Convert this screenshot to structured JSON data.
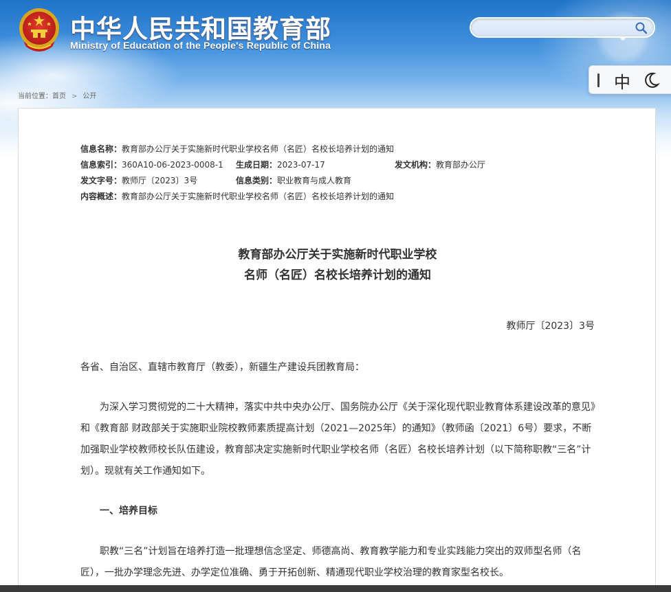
{
  "header": {
    "title": "中华人民共和国教育部",
    "subtitle": "Ministry of Education of the People's Republic of China",
    "search": {
      "value": "",
      "placeholder": ""
    },
    "colors": {
      "sky_top": "#1f74c9",
      "sky_bottom": "#eef6fd"
    }
  },
  "ime": {
    "lang": "中",
    "icon": "moon-icon"
  },
  "breadcrumb": {
    "label": "当前位置：",
    "items": [
      "首页",
      "公开"
    ]
  },
  "meta": {
    "rows": [
      [
        {
          "label": "信息名称：",
          "value": "教育部办公厅关于实施新时代职业学校名师（名匠）名校长培养计划的通知"
        }
      ],
      [
        {
          "label": "信息索引：",
          "value": "360A10-06-2023-0008-1"
        },
        {
          "label": "生成日期：",
          "value": "2023-07-17"
        },
        {
          "label": "发文机构：",
          "value": "教育部办公厅"
        }
      ],
      [
        {
          "label": "发文字号：",
          "value": "教师厅〔2023〕3号"
        },
        {
          "label": "信息类别：",
          "value": "职业教育与成人教育"
        }
      ],
      [
        {
          "label": "内容概述：",
          "value": "教育部办公厅关于实施新时代职业学校名师（名匠）名校长培养计划的通知"
        }
      ]
    ]
  },
  "document": {
    "title_line1": "教育部办公厅关于实施新时代职业学校",
    "title_line2": "名师（名匠）名校长培养计划的通知",
    "number": "教师厅〔2023〕3号",
    "salutation": "各省、自治区、直辖市教育厅（教委），新疆生产建设兵团教育局：",
    "paragraph1": "为深入学习贯彻党的二十大精神，落实中共中央办公厅、国务院办公厅《关于深化现代职业教育体系建设改革的意见》和《教育部 财政部关于实施职业院校教师素质提高计划（2021—2025年）的通知》（教师函〔2021〕6号）要求，不断加强职业学校教师校长队伍建设，教育部决定实施新时代职业学校名师（名匠）名校长培养计划（以下简称职教“三名”计划）。现就有关工作通知如下。",
    "heading1": "一、培养目标",
    "paragraph2": "职教“三名”计划旨在培养打造一批理想信念坚定、师德高尚、教育教学能力和专业实践能力突出的双师型名师（名匠），一批办学理念先进、办学定位准确、勇于开拓创新、精通现代职业学校治理的教育家型名校长。"
  }
}
